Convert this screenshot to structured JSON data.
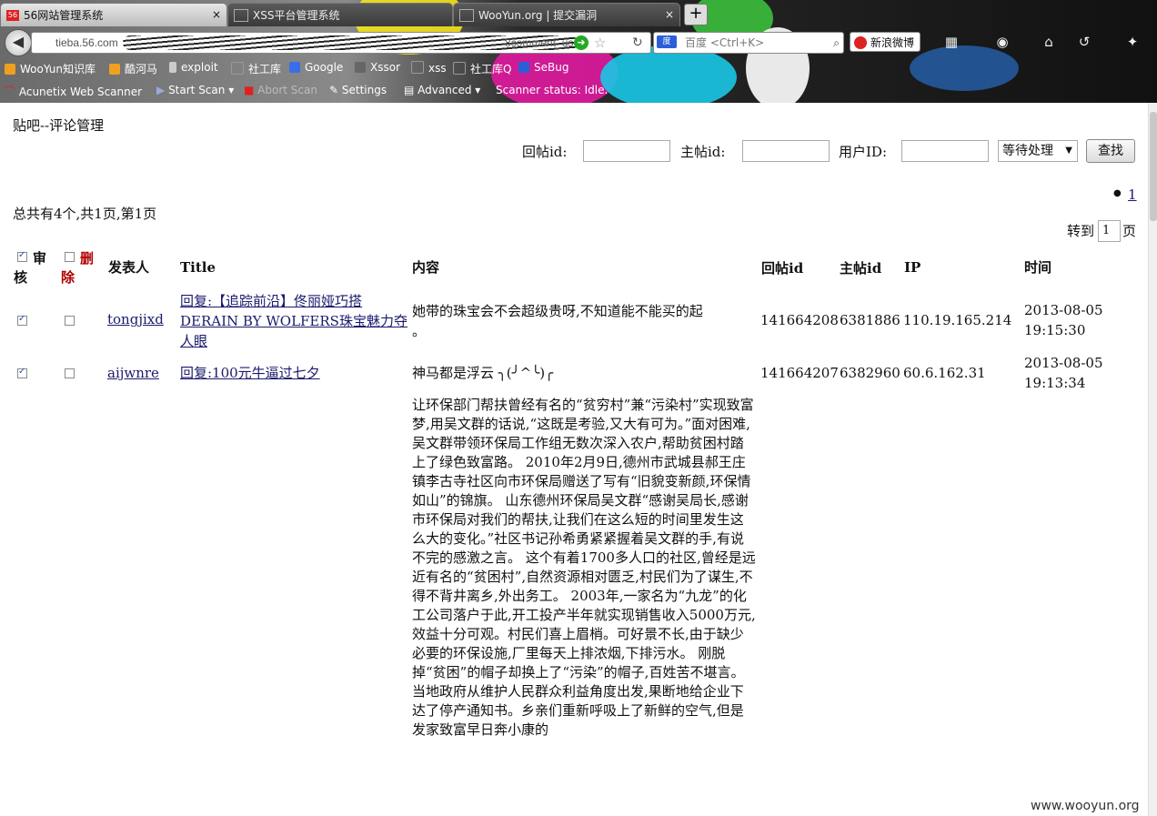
{
  "browser": {
    "tabs": [
      {
        "label": "56网站管理系统",
        "favicon": "56"
      },
      {
        "label": "XSS平台管理系统"
      },
      {
        "label": "WooYun.org | 提交漏洞"
      }
    ],
    "new_tab": "+",
    "url_host": "tieba.56.com",
    "url_tail": "8comment_use",
    "search_placeholder": "百度 <Ctrl+K>",
    "search_engine": "百度",
    "weibo_label": "新浪微博",
    "bookmarks": [
      "WooYun知识库",
      "酷河马",
      "exploit",
      "社工库",
      "Google",
      "Xssor",
      "xss",
      "社工库Q",
      "SeBug"
    ],
    "scanner": {
      "name": "Acunetix Web Scanner",
      "start": "Start Scan",
      "abort": "Abort Scan",
      "settings": "Settings",
      "advanced": "Advanced",
      "status": "Scanner status: Idle."
    }
  },
  "page": {
    "title": "贴吧--评论管理",
    "filters": {
      "reply_id_label": "回帖id:",
      "post_id_label": "主帖id:",
      "user_id_label": "用户ID:",
      "status_value": "等待处理",
      "search_button": "查找"
    },
    "pagination": {
      "summary": "总共有4个,共1页,第1页",
      "page_link": "1",
      "goto_label": "转到",
      "goto_value": "1",
      "goto_suffix": "页"
    },
    "table": {
      "headers": {
        "audit_1": "审",
        "audit_2": "核",
        "delete_1": "删",
        "delete_2": "除",
        "author": "发表人",
        "title": "Title",
        "content": "内容",
        "reply_id": "回帖id",
        "post_id": "主帖id",
        "ip": "IP",
        "time": "时间"
      },
      "rows": [
        {
          "author": "tongjixd",
          "title_1": "回复:【追踪前沿】佟丽娅巧搭",
          "title_2": "DERAIN BY WOLFERS珠宝魅力夺",
          "title_3": "人眼",
          "content_1": "她带的珠宝会不会超级贵呀,不知道能不能买的起",
          "content_2": "。",
          "reply_id": "141664208",
          "post_id": "6381886",
          "ip": "110.19.165.214",
          "date": "2013-08-05",
          "time": "19:15:30"
        },
        {
          "author": "aijwnre",
          "title_1": "回复:100元牛逼过七夕",
          "content_1": "神马都是浮云 ╮(╯^╰)╭",
          "content_body": "      让环保部门帮扶曾经有名的“贫穷村”兼“污染村”实现致富梦,用吴文群的话说,“这既是考验,又大有可为。”面对困难,吴文群带领环保局工作组无数次深入农户,帮助贫困村踏上了绿色致富路。        2010年2月9日,德州市武城县郝王庄镇李古寺社区向市环保局赠送了写有“旧貌变新颜,环保情如山”的锦旗。           山东德州环保局吴文群“感谢吴局长,感谢市环保局对我们的帮扶,让我们在这么短的时间里发生这么大的变化。”社区书记孙希勇紧紧握着吴文群的手,有说不完的感激之言。           这个有着1700多人口的社区,曾经是远近有名的“贫困村”,自然资源相对匮乏,村民们为了谋生,不得不背井离乡,外出务工。          2003年,一家名为“九龙”的化工公司落户于此,开工投产半年就实现销售收入5000万元,效益十分可观。村民们喜上眉梢。可好景不长,由于缺少必要的环保设施,厂里每天上排浓烟,下排污水。          刚脱掉“贫困”的帽子却换上了“污染”的帽子,百姓苦不堪言。          当地政府从维护人民群众利益角度出发,果断地给企业下达了停产通知书。乡亲们重新呼吸上了新鲜的空气,但是发家致富早日奔小康的",
          "reply_id": "141664207",
          "post_id": "6382960",
          "ip": "60.6.162.31",
          "date": "2013-08-05",
          "time": "19:13:34"
        }
      ]
    },
    "watermark": "www.wooyun.org"
  }
}
